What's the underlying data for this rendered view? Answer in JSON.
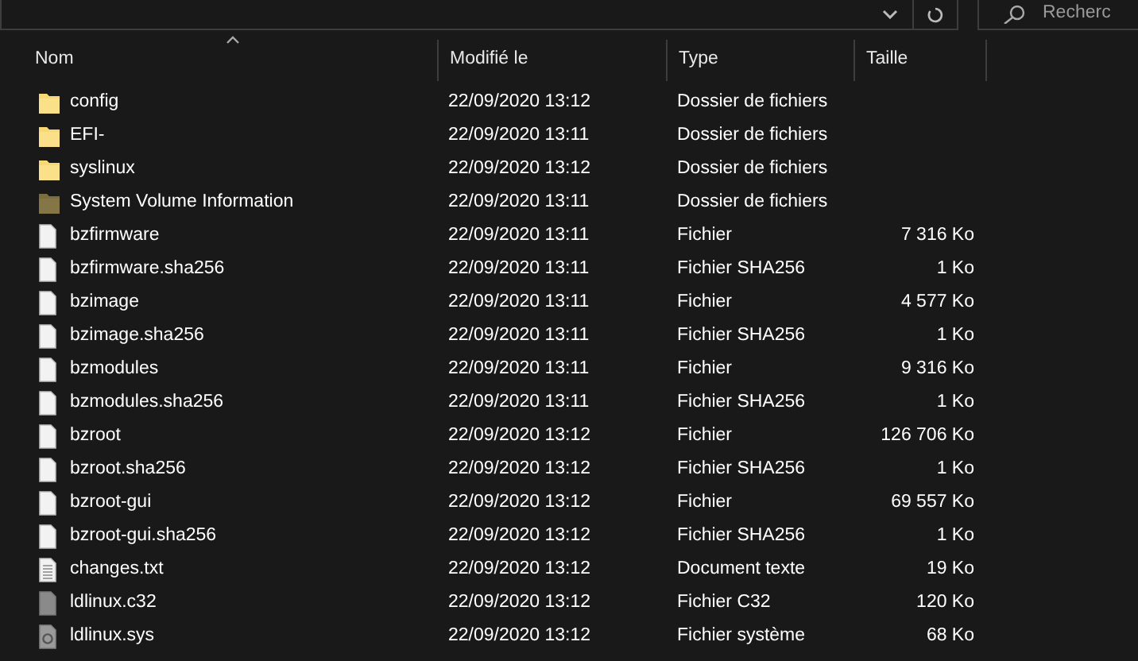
{
  "toolbar": {
    "search": {
      "placeholder": "Recherc"
    }
  },
  "columns": [
    {
      "label": "Nom",
      "sorted": true
    },
    {
      "label": "Modifié le",
      "sorted": false
    },
    {
      "label": "Type",
      "sorted": false
    },
    {
      "label": "Taille",
      "sorted": false
    }
  ],
  "rows": [
    {
      "kind": "folder",
      "name": "config",
      "modified": "22/09/2020 13:12",
      "type": "Dossier de fichiers"
    },
    {
      "kind": "folder",
      "name": "EFI-",
      "modified": "22/09/2020 13:11",
      "type": "Dossier de fichiers"
    },
    {
      "kind": "folder",
      "name": "syslinux",
      "modified": "22/09/2020 13:12",
      "type": "Dossier de fichiers"
    },
    {
      "kind": "system-folder",
      "name": "System Volume Information",
      "modified": "22/09/2020 13:11",
      "type": "Dossier de fichiers"
    },
    {
      "kind": "file",
      "name": "bzfirmware",
      "modified": "22/09/2020 13:11",
      "type": "Fichier",
      "size": "7 316 Ko"
    },
    {
      "kind": "file",
      "name": "bzfirmware.sha256",
      "modified": "22/09/2020 13:11",
      "type": "Fichier SHA256",
      "size": "1 Ko"
    },
    {
      "kind": "file",
      "name": "bzimage",
      "modified": "22/09/2020 13:11",
      "type": "Fichier",
      "size": "4 577 Ko"
    },
    {
      "kind": "file",
      "name": "bzimage.sha256",
      "modified": "22/09/2020 13:11",
      "type": "Fichier SHA256",
      "size": "1 Ko"
    },
    {
      "kind": "file",
      "name": "bzmodules",
      "modified": "22/09/2020 13:11",
      "type": "Fichier",
      "size": "9 316 Ko"
    },
    {
      "kind": "file",
      "name": "bzmodules.sha256",
      "modified": "22/09/2020 13:11",
      "type": "Fichier SHA256",
      "size": "1 Ko"
    },
    {
      "kind": "file",
      "name": "bzroot",
      "modified": "22/09/2020 13:12",
      "type": "Fichier",
      "size": "126 706 Ko"
    },
    {
      "kind": "file",
      "name": "bzroot.sha256",
      "modified": "22/09/2020 13:12",
      "type": "Fichier SHA256",
      "size": "1 Ko"
    },
    {
      "kind": "file",
      "name": "bzroot-gui",
      "modified": "22/09/2020 13:12",
      "type": "Fichier",
      "size": "69 557 Ko"
    },
    {
      "kind": "file",
      "name": "bzroot-gui.sha256",
      "modified": "22/09/2020 13:12",
      "type": "Fichier SHA256",
      "size": "1 Ko"
    },
    {
      "kind": "text",
      "name": "changes.txt",
      "modified": "22/09/2020 13:12",
      "type": "Document texte",
      "size": "19 Ko"
    },
    {
      "kind": "binary",
      "name": "ldlinux.c32",
      "modified": "22/09/2020 13:12",
      "type": "Fichier C32",
      "size": "120 Ko"
    },
    {
      "kind": "system",
      "name": "ldlinux.sys",
      "modified": "22/09/2020 13:12",
      "type": "Fichier système",
      "size": "68 Ko"
    }
  ]
}
